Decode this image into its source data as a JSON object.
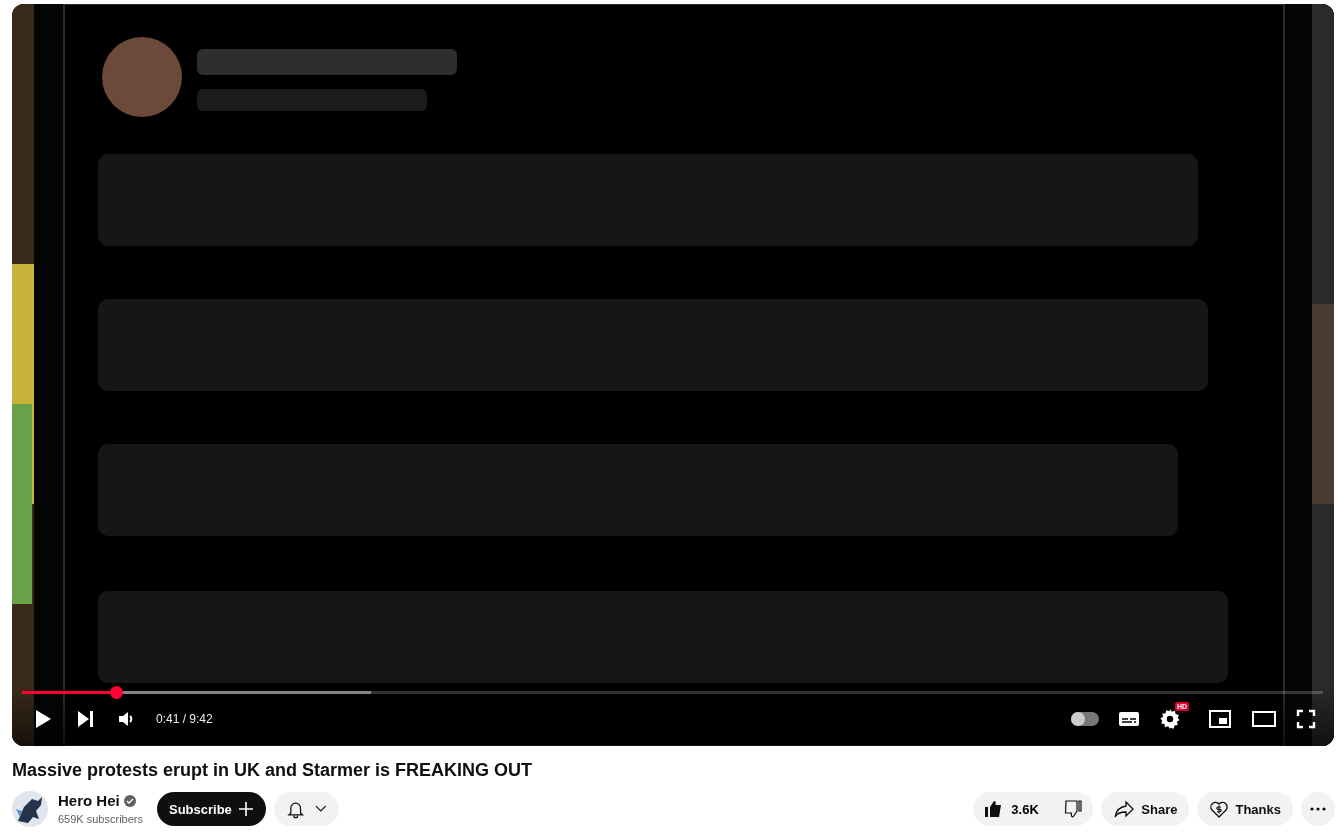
{
  "video": {
    "kind": "picture",
    "progress": {
      "level": 0.072
    },
    "buffer": {
      "level": 0.268
    },
    "time": "0:41 / 9:42",
    "autoplay": {
      "on": false
    },
    "quality_badge": "HD"
  },
  "title": "Massive protests erupt in UK and Starmer is FREAKING OUT",
  "channel": {
    "name": "Hero Hei",
    "verified": true,
    "subscribers": "659K subscribers"
  },
  "subscribe": "Subscribe",
  "actions": {
    "likes": "3.6K",
    "share": "Share",
    "thanks": "Thanks"
  }
}
